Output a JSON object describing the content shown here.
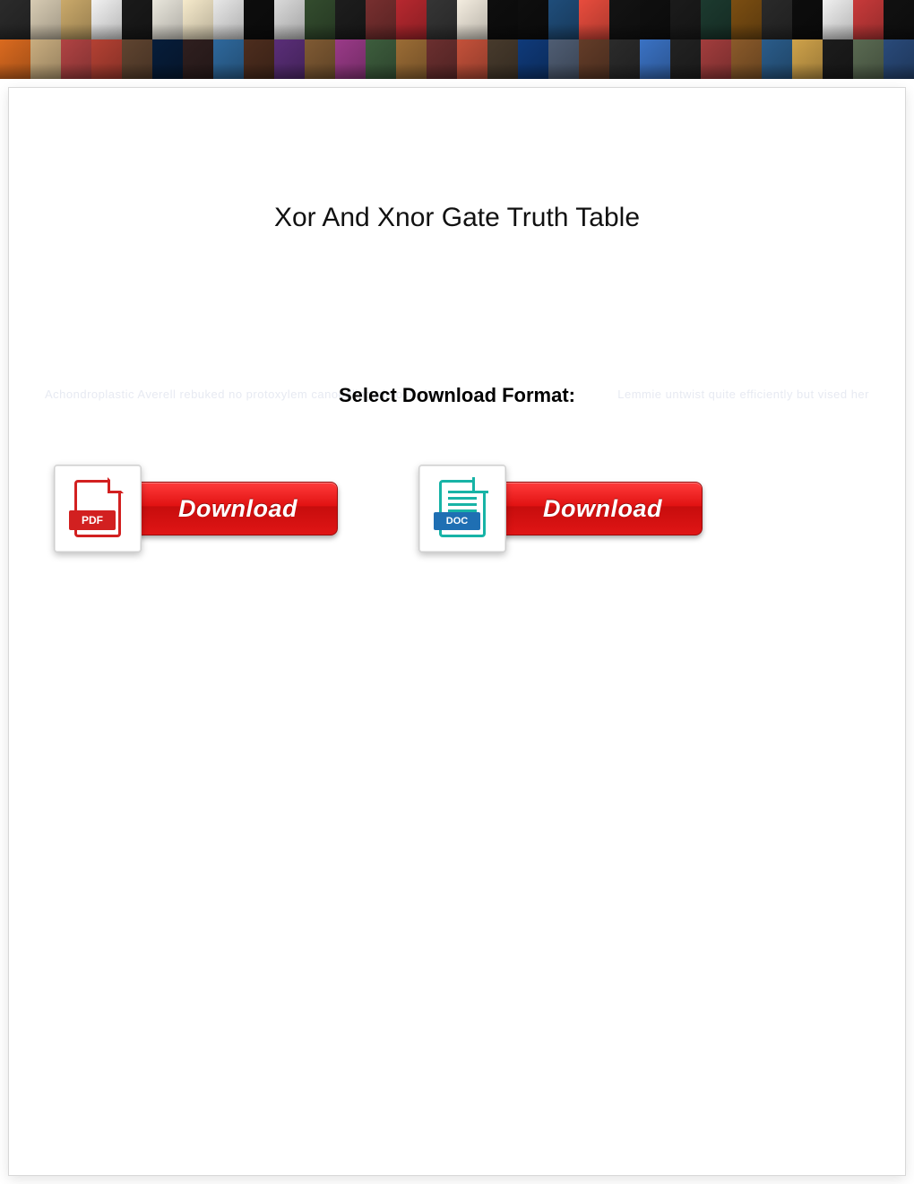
{
  "header": {
    "tile_colors": [
      "#2b2b2b",
      "#d7cbb3",
      "#caa96a",
      "#f2f2f2",
      "#1a1a1a",
      "#e9e6dc",
      "#f6eacb",
      "#e8e8e8",
      "#0d0d0d",
      "#dadada",
      "#334c2e",
      "#1d1d1d",
      "#772f2f",
      "#b7282f",
      "#353535",
      "#f4ede0",
      "#0e0e0e",
      "#0e0e0e",
      "#1f4d7a",
      "#e84c3d",
      "#131313",
      "#0f0f0f",
      "#1b1b1b",
      "#1c3a2f",
      "#7b4e12",
      "#2a2a2a",
      "#0d0d0d",
      "#f0f0f0",
      "#c83a3a",
      "#111111",
      "#da6a1f",
      "#c9ad7f",
      "#b04343",
      "#b44133",
      "#5f4430",
      "#071d3a",
      "#2f1f1f",
      "#2e689c",
      "#4d2d1e",
      "#5a2e78",
      "#7f5a33",
      "#9a3a88",
      "#3d5d3d",
      "#9b6c35",
      "#6b2f2f",
      "#c4513a",
      "#473a2c",
      "#0f3a7a",
      "#4f5d73",
      "#633c28",
      "#2b2b2b",
      "#3a72c4",
      "#222",
      "#a23d3d",
      "#8a5a2a",
      "#2a5c8a",
      "#cfa24a",
      "#1c1c1c",
      "#5a6a52",
      "#294a7a"
    ]
  },
  "page": {
    "title": "Xor And Xnor Gate Truth Table",
    "select_label": "Select Download Format:",
    "faint_left": "Achondroplastic Averell rebuked no protoxylem canoodling almost after",
    "faint_right": "Lemmie untwist quite efficiently but vised her"
  },
  "downloads": {
    "pdf": {
      "badge_label": "PDF",
      "button_label": "Download"
    },
    "doc": {
      "badge_label": "DOC",
      "button_label": "Download"
    }
  }
}
